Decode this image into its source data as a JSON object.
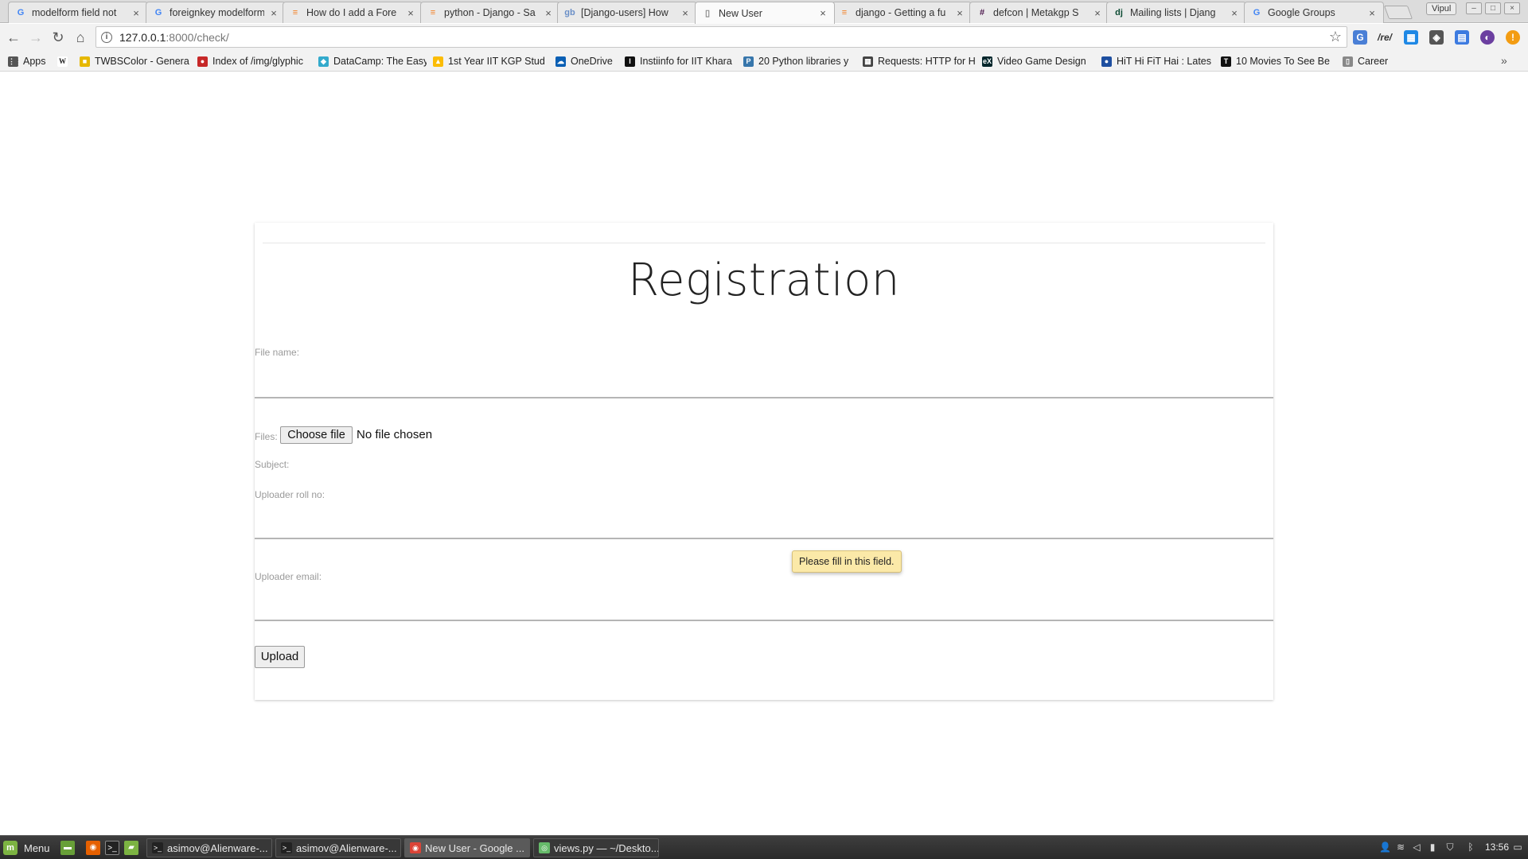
{
  "browser": {
    "tabs": [
      {
        "title": "modelform field not",
        "icon": "google-icon",
        "color": "#4285f4",
        "glyph": "G"
      },
      {
        "title": "foreignkey modelform",
        "icon": "google-icon",
        "color": "#4285f4",
        "glyph": "G"
      },
      {
        "title": "How do I add a Fore",
        "icon": "stackoverflow-icon",
        "color": "#f48024",
        "glyph": "≡"
      },
      {
        "title": "python - Django - Sa",
        "icon": "stackoverflow-icon",
        "color": "#f48024",
        "glyph": "≡"
      },
      {
        "title": "[Django-users] How",
        "icon": "gmane-icon",
        "color": "#6a8fc7",
        "glyph": "gb"
      },
      {
        "title": "New User",
        "icon": "page-icon",
        "color": "#888888",
        "glyph": "▯",
        "active": true
      },
      {
        "title": "django - Getting a fu",
        "icon": "stackoverflow-icon",
        "color": "#f48024",
        "glyph": "≡"
      },
      {
        "title": "defcon | Metakgp S",
        "icon": "slack-icon",
        "color": "#4a154b",
        "glyph": "#"
      },
      {
        "title": "Mailing lists | Djang",
        "icon": "django-icon",
        "color": "#0c4b33",
        "glyph": "dj"
      },
      {
        "title": "Google Groups",
        "icon": "google-groups-icon",
        "color": "#4285f4",
        "glyph": "G"
      }
    ],
    "profile_name": "Vipul",
    "url_host": "127.0.0.1",
    "url_rest": ":8000/check/",
    "bookmarks": [
      {
        "label": "Apps",
        "icon": "apps-grid-icon",
        "color": "#555555",
        "glyph": "⋮⋮"
      },
      {
        "label": "",
        "icon": "wikipedia-icon",
        "color": "#ffffff",
        "glyph": "W"
      },
      {
        "label": "TWBSColor - Genera",
        "icon": "twbscolor-icon",
        "color": "#e6b800",
        "glyph": "■"
      },
      {
        "label": "Index of /img/glyphic",
        "icon": "glyphicons-icon",
        "color": "#c62828",
        "glyph": "●"
      },
      {
        "label": "DataCamp: The Easy",
        "icon": "datacamp-icon",
        "color": "#3ac",
        "glyph": "◆"
      },
      {
        "label": "1st Year IIT KGP Stud",
        "icon": "google-drive-icon",
        "color": "#fbbc05",
        "glyph": "▲"
      },
      {
        "label": "OneDrive",
        "icon": "onedrive-icon",
        "color": "#0a5fb4",
        "glyph": "☁"
      },
      {
        "label": "Instiinfo for IIT Khara",
        "icon": "instiinfo-icon",
        "color": "#111111",
        "glyph": "I"
      },
      {
        "label": "20 Python libraries y",
        "icon": "python-icon",
        "color": "#3776ab",
        "glyph": "P"
      },
      {
        "label": "Requests: HTTP for H",
        "icon": "requests-icon",
        "color": "#444444",
        "glyph": "▦"
      },
      {
        "label": "Video Game Design",
        "icon": "edx-icon",
        "color": "#02262b",
        "glyph": "eX"
      },
      {
        "label": "HiT Hi FiT Hai : Lates",
        "icon": "hithifithai-icon",
        "color": "#1e4fa0",
        "glyph": "●"
      },
      {
        "label": "10 Movies To See Be",
        "icon": "tc-icon",
        "color": "#111111",
        "glyph": "T"
      },
      {
        "label": "Career",
        "icon": "page-icon",
        "color": "#888888",
        "glyph": "▯"
      }
    ]
  },
  "page": {
    "title": "Registration",
    "labels": {
      "file_name": "File name:",
      "files": "Files:",
      "subject": "Subject:",
      "uploader_roll_no": "Uploader roll no:",
      "uploader_email": "Uploader email:"
    },
    "choose_file_label": "Choose file",
    "no_file_text": "No file chosen",
    "upload_label": "Upload",
    "validation_tooltip": "Please fill in this field."
  },
  "taskbar": {
    "menu_label": "Menu",
    "tasks": [
      {
        "label": "asimov@Alienware-...",
        "icon": "terminal-icon",
        "color": "#222222",
        "glyph": ">_"
      },
      {
        "label": "asimov@Alienware-...",
        "icon": "terminal-icon",
        "color": "#222222",
        "glyph": ">_"
      },
      {
        "label": "New User - Google ...",
        "icon": "chrome-icon",
        "color": "#db4437",
        "glyph": "◉",
        "active": true
      },
      {
        "label": "views.py — ~/Deskto...",
        "icon": "atom-icon",
        "color": "#66bb6a",
        "glyph": "◎"
      }
    ],
    "clock": "13:56"
  }
}
